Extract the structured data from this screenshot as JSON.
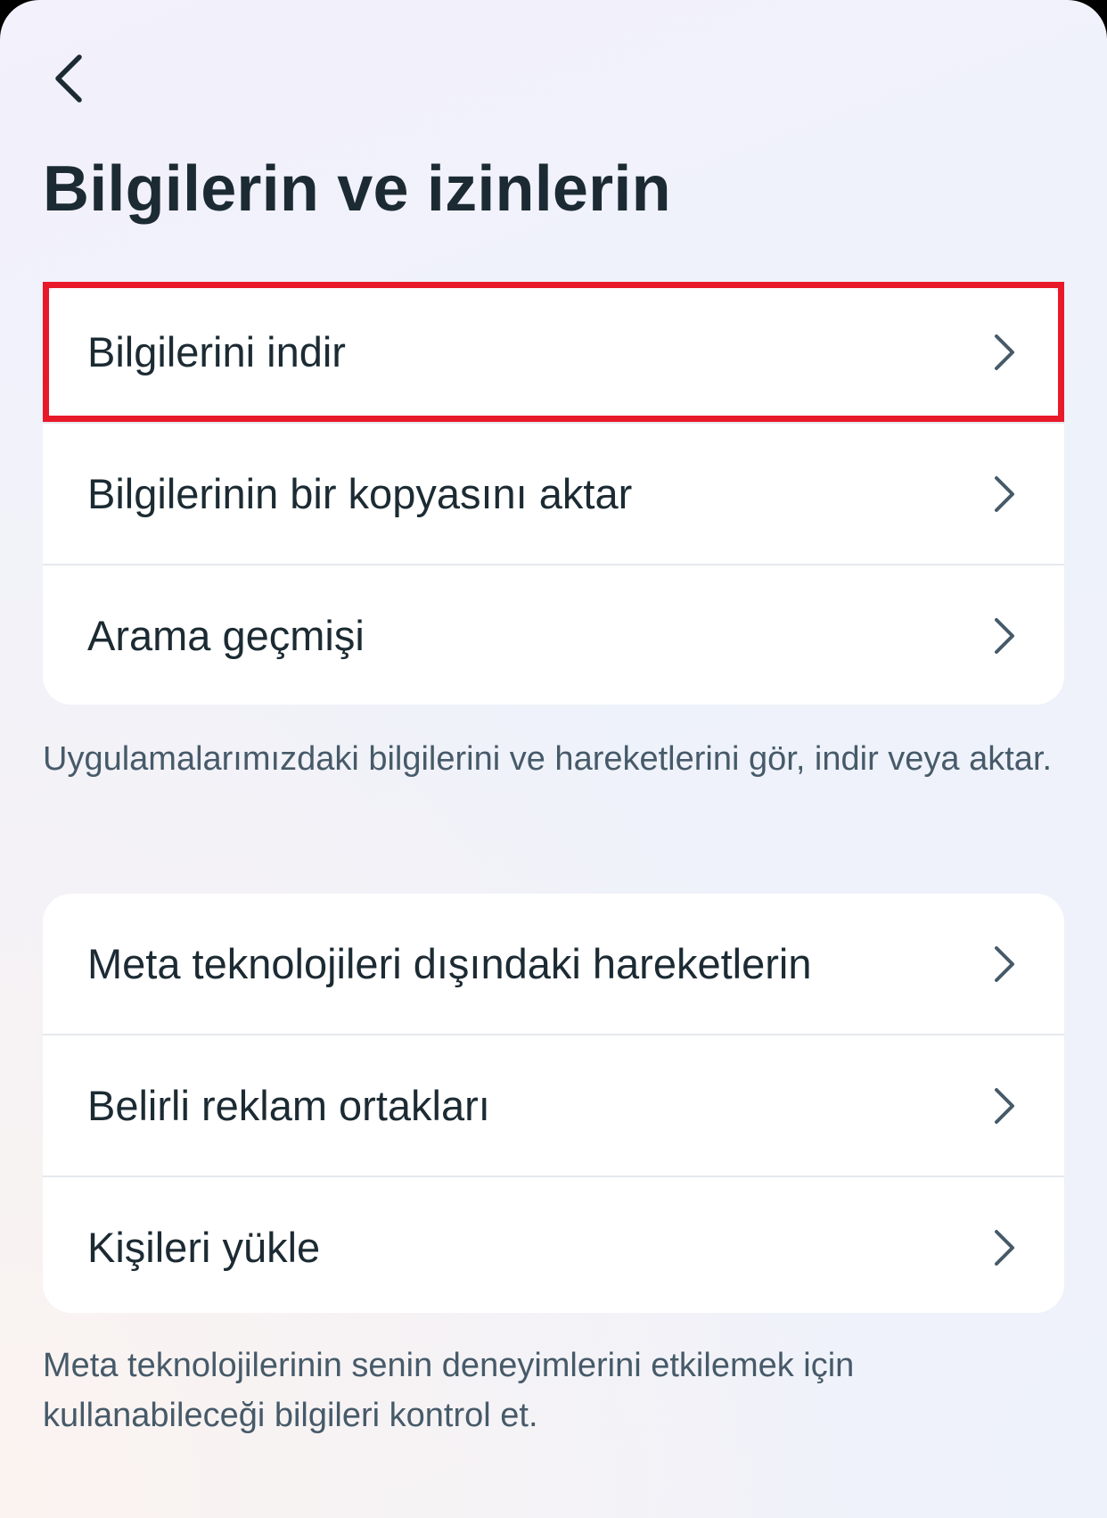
{
  "header": {
    "back_icon": "chevron-left-icon",
    "title": "Bilgilerin ve izinlerin"
  },
  "group1": {
    "items": [
      {
        "label": "Bilgilerini indir",
        "icon": "chevron-right-icon",
        "highlighted": true
      },
      {
        "label": "Bilgilerinin bir kopyasını aktar",
        "icon": "chevron-right-icon"
      },
      {
        "label": "Arama geçmişi",
        "icon": "chevron-right-icon"
      }
    ],
    "caption": "Uygulamalarımızdaki bilgilerini ve hareketlerini gör, indir veya aktar."
  },
  "group2": {
    "items": [
      {
        "label": "Meta teknolojileri dışındaki hareketlerin",
        "icon": "chevron-right-icon"
      },
      {
        "label": "Belirli reklam ortakları",
        "icon": "chevron-right-icon"
      },
      {
        "label": "Kişileri yükle",
        "icon": "chevron-right-icon"
      }
    ],
    "caption": "Meta teknolojilerinin senin deneyimlerini etkilemek için kullanabileceği bilgileri kontrol et."
  },
  "colors": {
    "highlight": "#e81a2a",
    "text_primary": "#1c2b33",
    "text_secondary": "#465a69"
  }
}
